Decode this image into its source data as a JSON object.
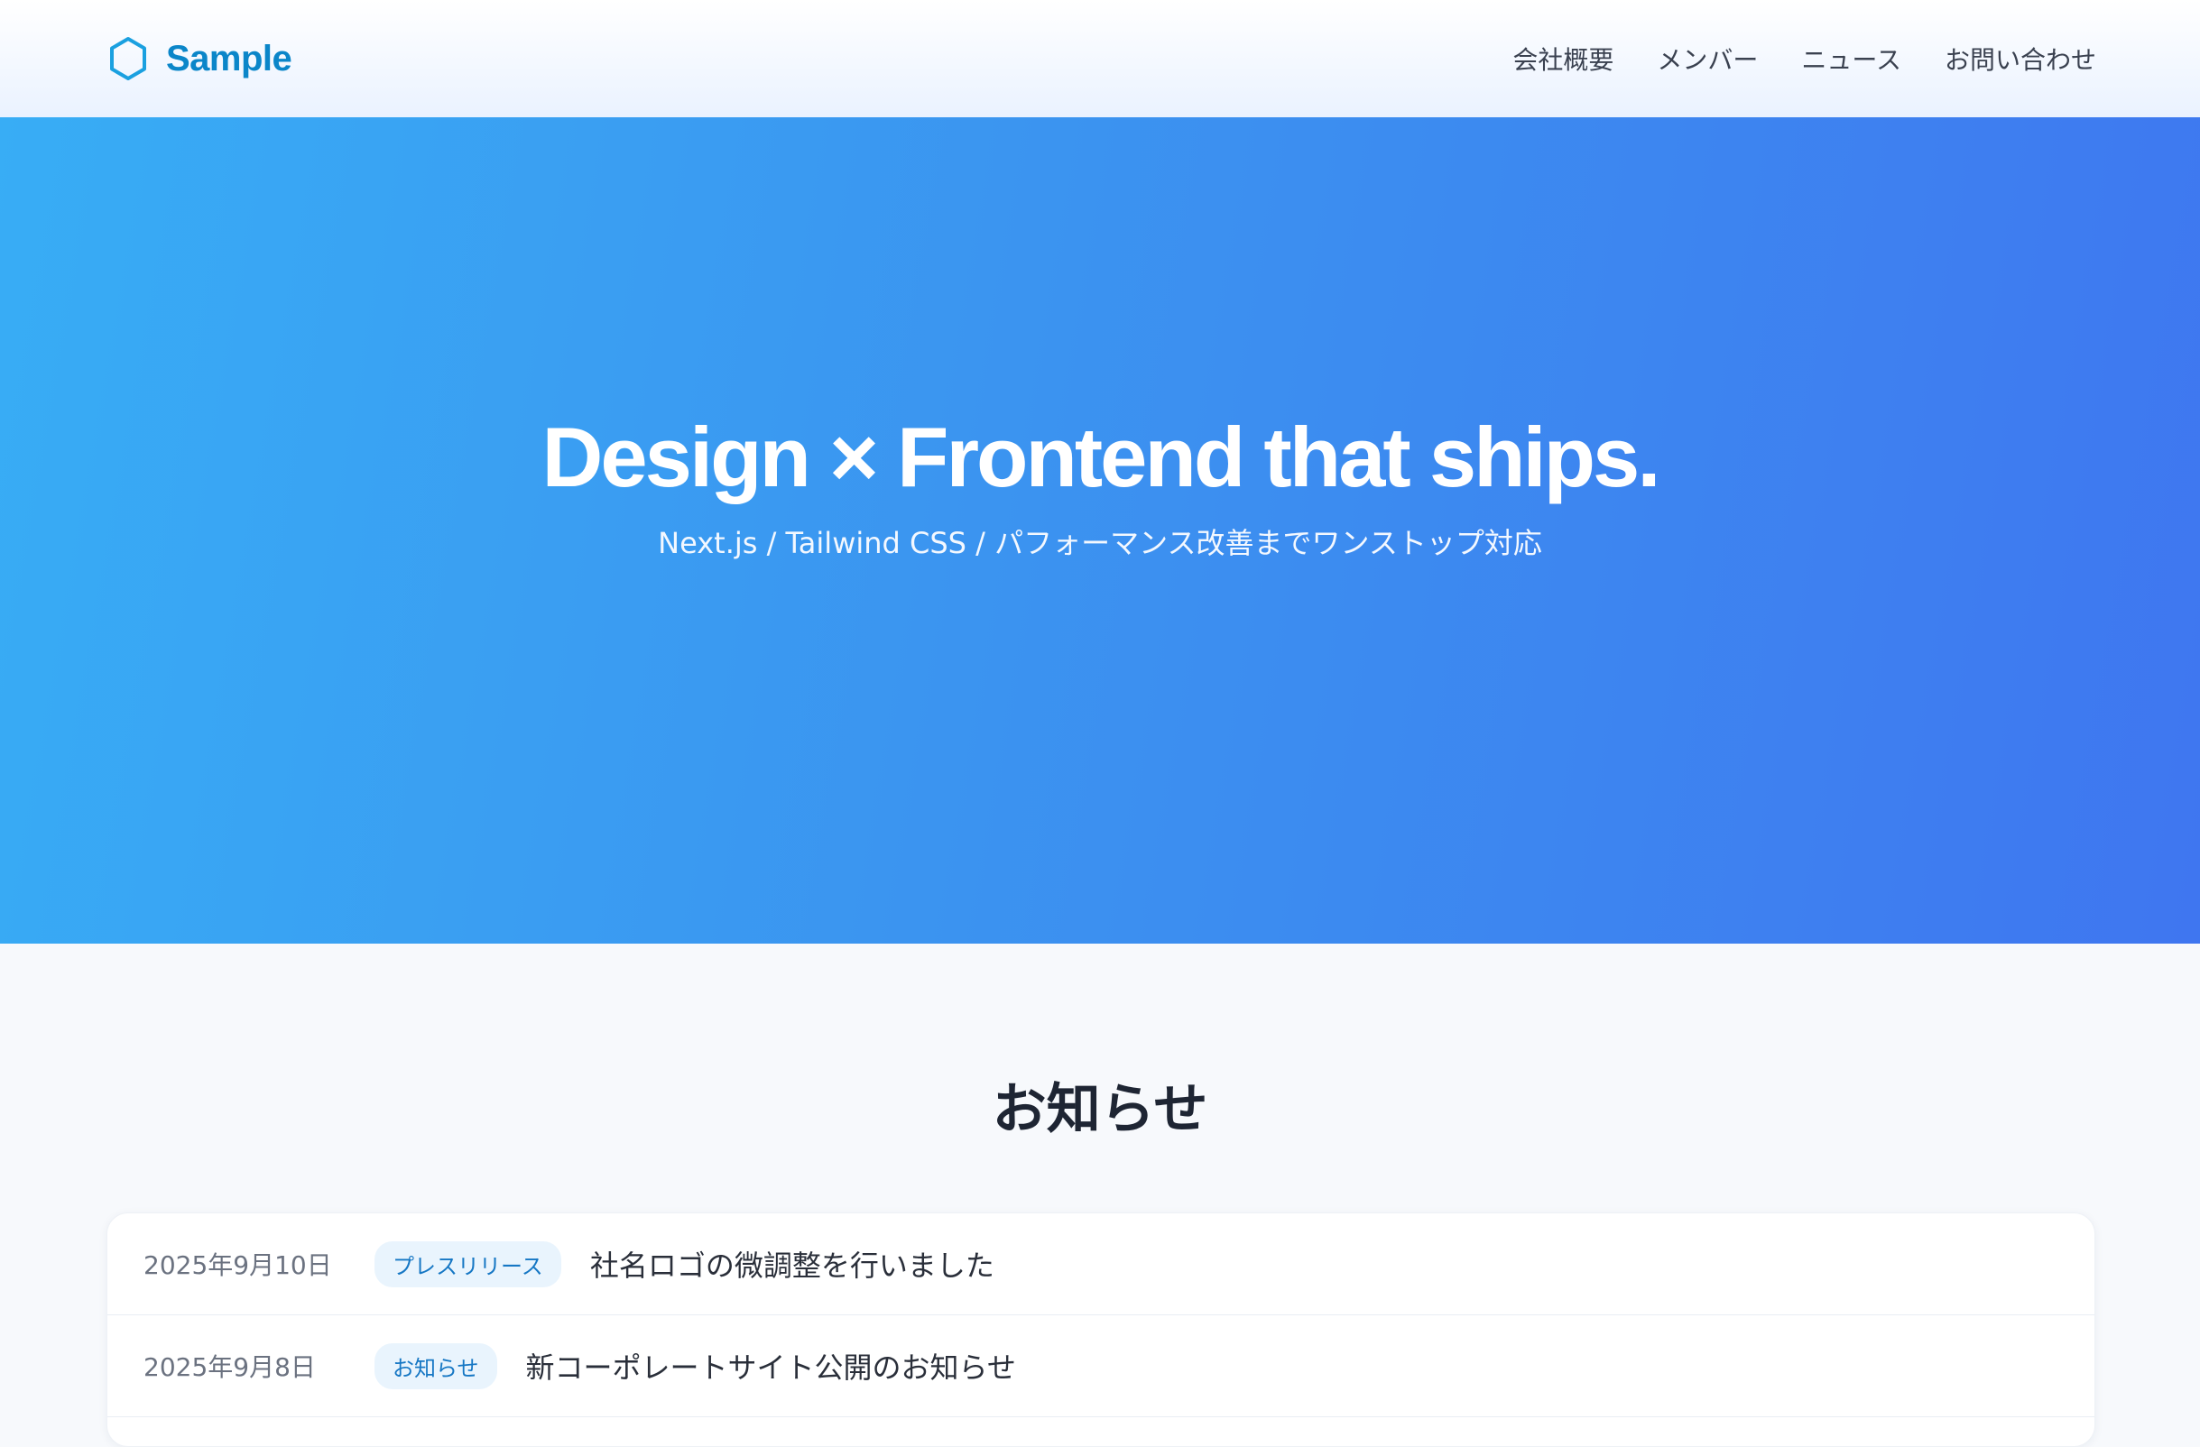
{
  "header": {
    "logo_text": "Sample",
    "nav": [
      {
        "label": "会社概要"
      },
      {
        "label": "メンバー"
      },
      {
        "label": "ニュース"
      },
      {
        "label": "お問い合わせ"
      }
    ]
  },
  "hero": {
    "title": "Design × Frontend that ships.",
    "subtitle": "Next.js / Tailwind CSS / パフォーマンス改善までワンストップ対応"
  },
  "news": {
    "heading": "お知らせ",
    "items": [
      {
        "date": "2025年9月10日",
        "category": "プレスリリース",
        "title": "社名ロゴの微調整を行いました"
      },
      {
        "date": "2025年9月8日",
        "category": "お知らせ",
        "title": "新コーポレートサイト公開のお知らせ"
      }
    ]
  },
  "colors": {
    "brand": "#0b86c9",
    "hero_gradient_start": "#38adf5",
    "hero_gradient_end": "#3f76f0",
    "badge_bg": "#e9f4fd",
    "badge_text": "#1677c4"
  },
  "icons": {
    "logo": "hexagon-icon"
  }
}
